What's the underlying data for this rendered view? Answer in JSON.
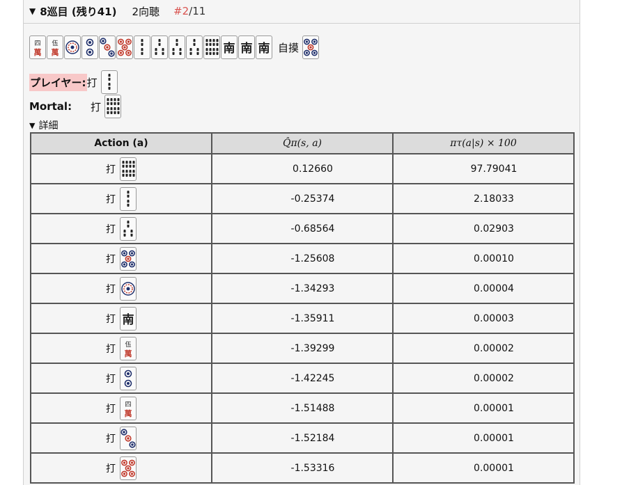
{
  "header": {
    "triangle": "▼",
    "round": "8巡目 (残り41)",
    "shanten": "2向聴",
    "index": "#2",
    "total": "/11"
  },
  "hand": {
    "tiles": [
      {
        "name": "4m-tile",
        "kind": "man",
        "label": "四"
      },
      {
        "name": "5m-red-tile",
        "kind": "man",
        "label": "伍"
      },
      {
        "name": "1p-tile",
        "kind": "pin1"
      },
      {
        "name": "2p-tile",
        "kind": "pin2"
      },
      {
        "name": "3p-tile",
        "kind": "pin3"
      },
      {
        "name": "5p-red-tile",
        "kind": "pin5r"
      },
      {
        "name": "2s-tile",
        "kind": "sou2"
      },
      {
        "name": "3s-tile",
        "kind": "sou3"
      },
      {
        "name": "3s-tile",
        "kind": "sou3"
      },
      {
        "name": "3s-tile",
        "kind": "sou3"
      },
      {
        "name": "8s-tile",
        "kind": "sou8"
      },
      {
        "name": "south-tile",
        "kind": "honor",
        "label": "南"
      },
      {
        "name": "south-tile",
        "kind": "honor",
        "label": "南"
      },
      {
        "name": "south-tile",
        "kind": "honor",
        "label": "南"
      }
    ],
    "draw_label": "自摸",
    "drawn_tile": {
      "name": "5p-tile",
      "kind": "pin5"
    }
  },
  "player": {
    "label": "プレイヤー:",
    "verb": "打",
    "tile": {
      "name": "2s-tile",
      "kind": "sou2"
    }
  },
  "mortal": {
    "label": "Mortal:",
    "verb": "打",
    "tile": {
      "name": "8s-tile",
      "kind": "sou8"
    }
  },
  "details": {
    "triangle": "▼",
    "label": "詳細"
  },
  "table": {
    "headers": [
      "Action (a)",
      "Q̂π(s, a)",
      "πτ(a|s) × 100"
    ],
    "rows": [
      {
        "verb": "打",
        "tile": {
          "name": "8s-tile",
          "kind": "sou8"
        },
        "q": "0.12660",
        "p": "97.79041"
      },
      {
        "verb": "打",
        "tile": {
          "name": "2s-tile",
          "kind": "sou2"
        },
        "q": "-0.25374",
        "p": "2.18033"
      },
      {
        "verb": "打",
        "tile": {
          "name": "3s-tile",
          "kind": "sou3"
        },
        "q": "-0.68564",
        "p": "0.02903"
      },
      {
        "verb": "打",
        "tile": {
          "name": "5p-tile",
          "kind": "pin5"
        },
        "q": "-1.25608",
        "p": "0.00010"
      },
      {
        "verb": "打",
        "tile": {
          "name": "1p-tile",
          "kind": "pin1"
        },
        "q": "-1.34293",
        "p": "0.00004"
      },
      {
        "verb": "打",
        "tile": {
          "name": "south-tile",
          "kind": "honor",
          "label": "南"
        },
        "q": "-1.35911",
        "p": "0.00003"
      },
      {
        "verb": "打",
        "tile": {
          "name": "5m-red-tile",
          "kind": "man",
          "label": "伍"
        },
        "q": "-1.39299",
        "p": "0.00002"
      },
      {
        "verb": "打",
        "tile": {
          "name": "2p-tile",
          "kind": "pin2"
        },
        "q": "-1.42245",
        "p": "0.00002"
      },
      {
        "verb": "打",
        "tile": {
          "name": "4m-tile",
          "kind": "man",
          "label": "四"
        },
        "q": "-1.51488",
        "p": "0.00001"
      },
      {
        "verb": "打",
        "tile": {
          "name": "3p-tile",
          "kind": "pin3"
        },
        "q": "-1.52184",
        "p": "0.00001"
      },
      {
        "verb": "打",
        "tile": {
          "name": "5p-red-tile",
          "kind": "pin5r"
        },
        "q": "-1.53316",
        "p": "0.00001"
      }
    ]
  },
  "colors": {
    "highlight": "#f8c8c8",
    "index_red": "#d9534f",
    "tile_red": "#c0392b",
    "tile_blue": "#1f2f6b",
    "tile_green": "#1e6b3a",
    "tile_black": "#222222"
  }
}
